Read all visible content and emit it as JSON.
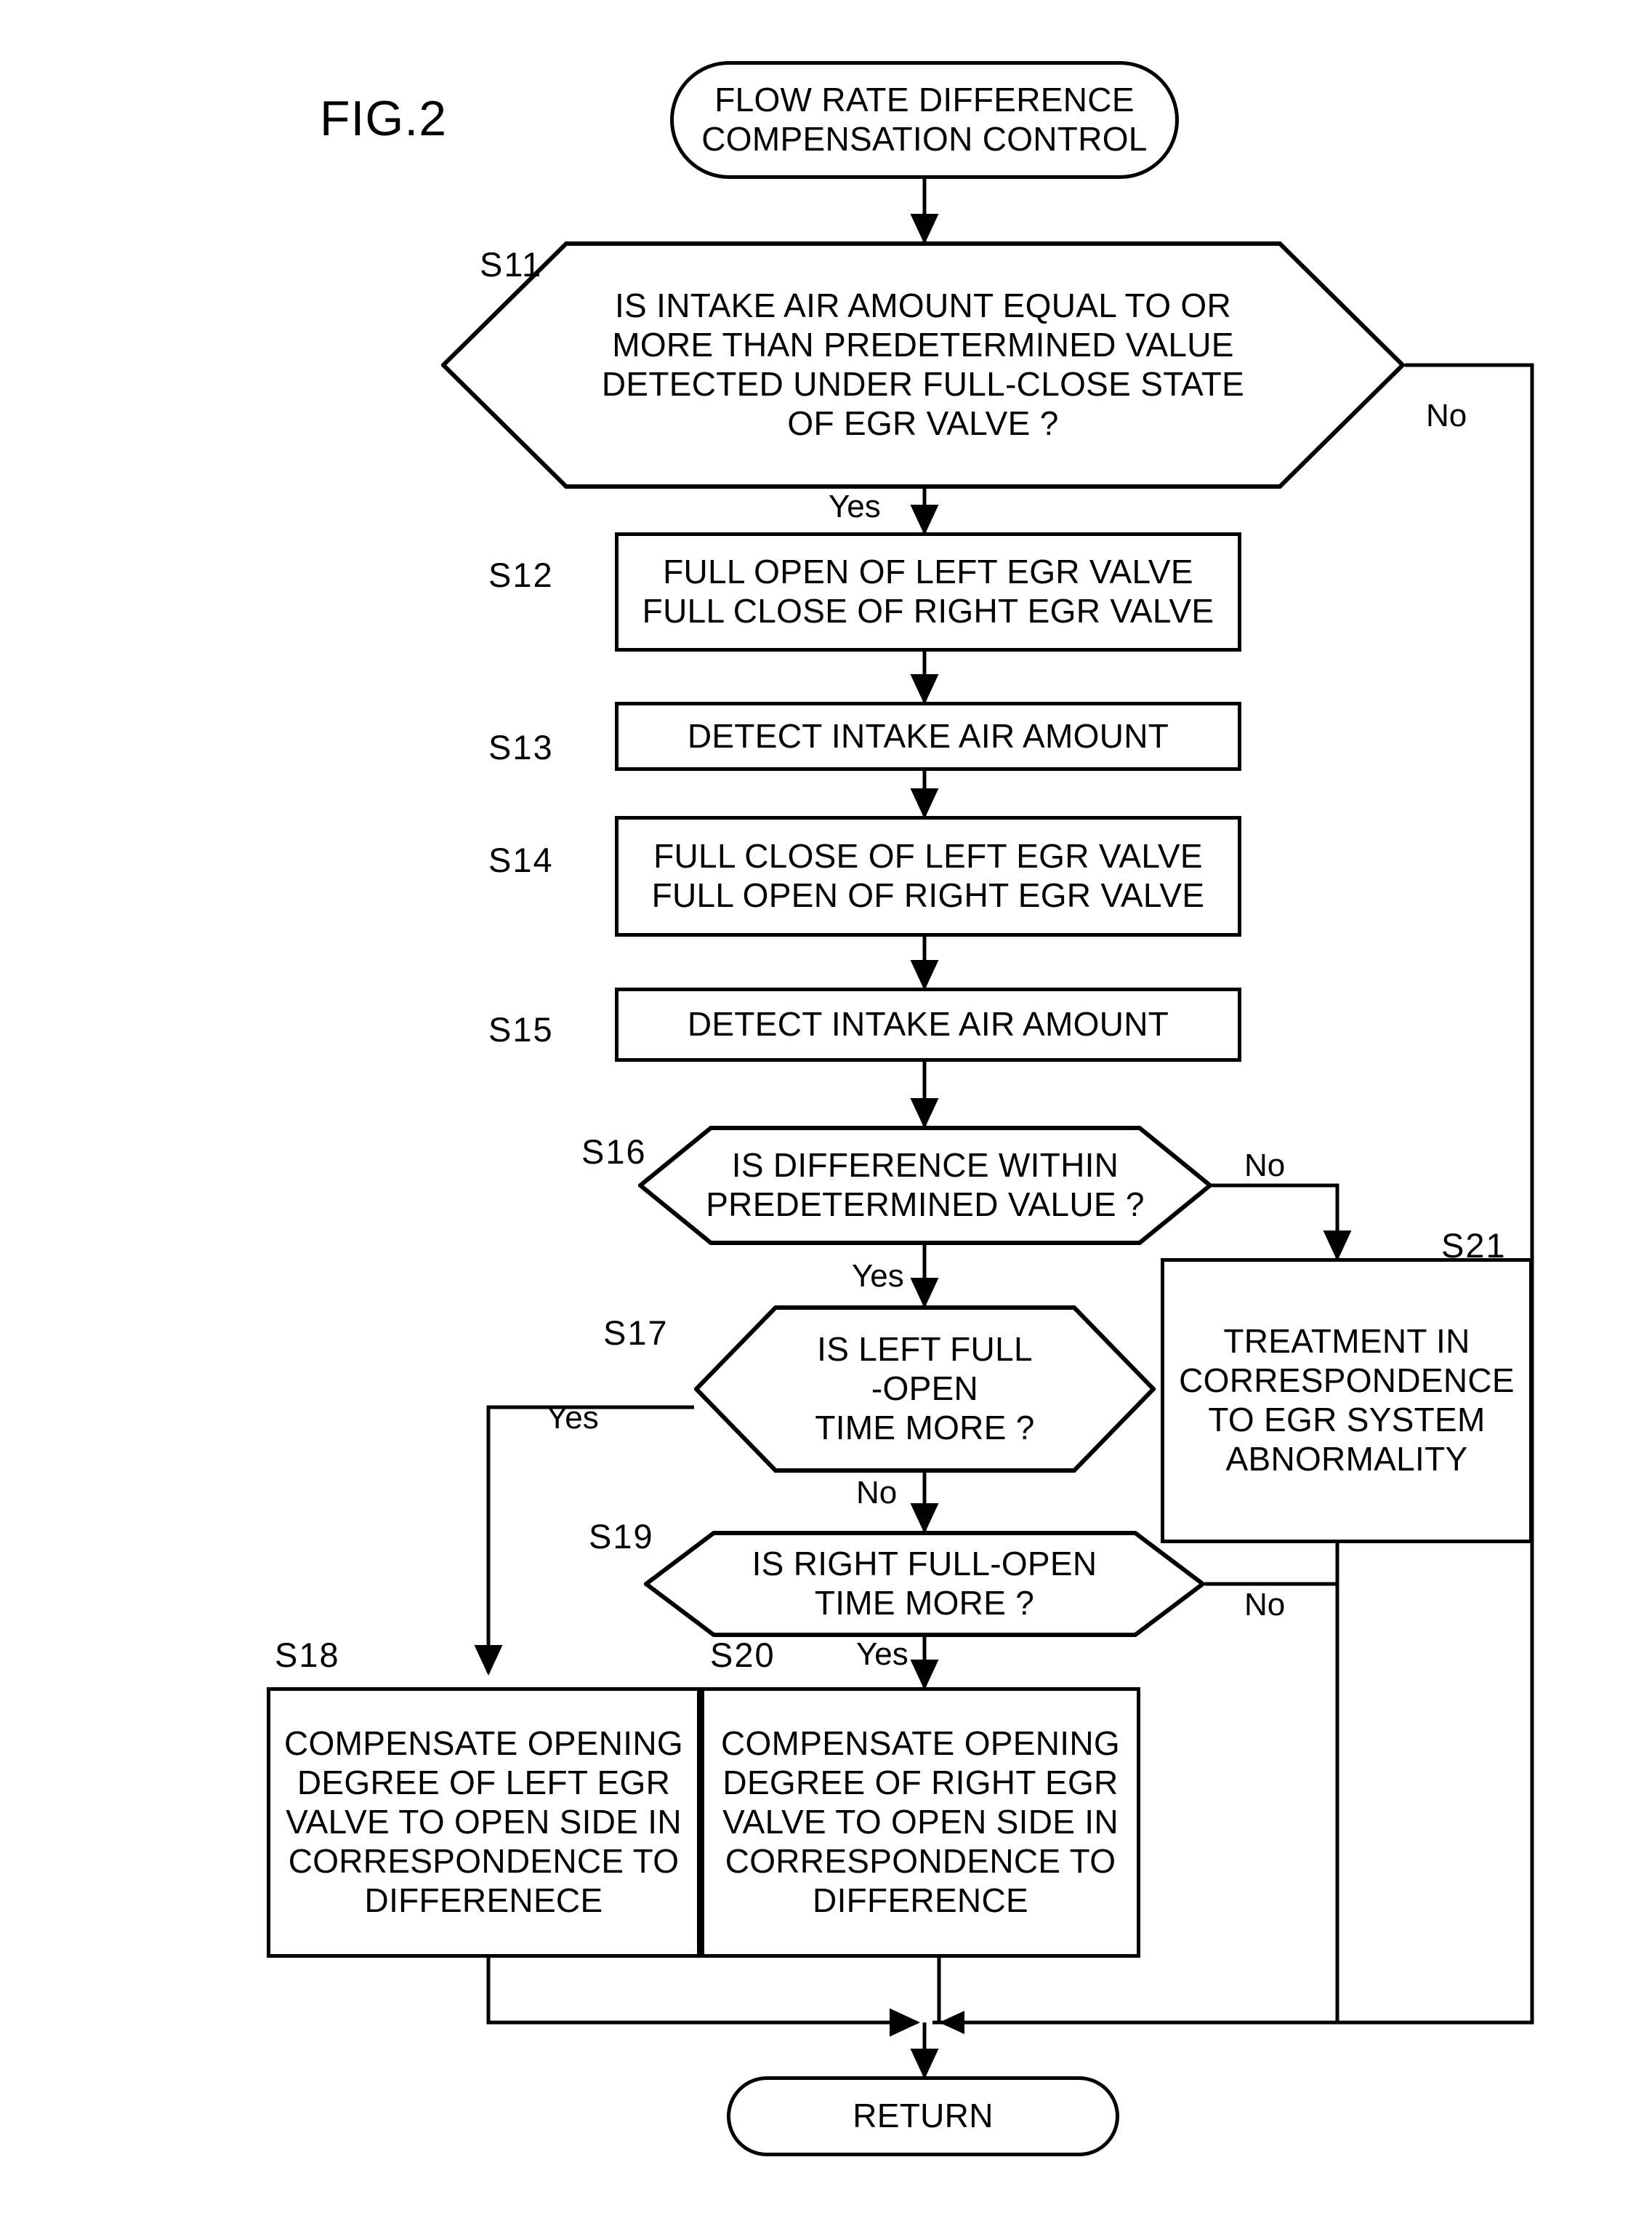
{
  "figure": {
    "label": "FIG.2"
  },
  "nodes": {
    "start": {
      "id": "start",
      "type": "terminator",
      "text": "FLOW RATE DIFFERENCE\nCOMPENSATION CONTROL"
    },
    "s11": {
      "id": "S11",
      "type": "decision",
      "step": "S11",
      "text": "IS INTAKE AIR AMOUNT EQUAL TO OR\nMORE THAN PREDETERMINED VALUE\nDETECTED UNDER FULL-CLOSE STATE\nOF EGR VALVE ?"
    },
    "s12": {
      "id": "S12",
      "type": "process",
      "step": "S12",
      "text": "FULL OPEN OF LEFT EGR VALVE\nFULL CLOSE OF RIGHT EGR VALVE"
    },
    "s13": {
      "id": "S13",
      "type": "process",
      "step": "S13",
      "text": "DETECT INTAKE AIR AMOUNT"
    },
    "s14": {
      "id": "S14",
      "type": "process",
      "step": "S14",
      "text": "FULL CLOSE OF LEFT EGR VALVE\nFULL OPEN OF RIGHT EGR VALVE"
    },
    "s15": {
      "id": "S15",
      "type": "process",
      "step": "S15",
      "text": "DETECT INTAKE AIR AMOUNT"
    },
    "s16": {
      "id": "S16",
      "type": "decision",
      "step": "S16",
      "text": "IS DIFFERENCE WITHIN\nPREDETERMINED VALUE ?"
    },
    "s17": {
      "id": "S17",
      "type": "decision",
      "step": "S17",
      "text": "IS LEFT FULL\n-OPEN\nTIME MORE ?"
    },
    "s19": {
      "id": "S19",
      "type": "decision",
      "step": "S19",
      "text": "IS RIGHT FULL-OPEN\nTIME MORE ?"
    },
    "s18": {
      "id": "S18",
      "type": "process",
      "step": "S18",
      "text": "COMPENSATE OPENING\nDEGREE OF LEFT EGR\nVALVE TO OPEN SIDE IN\nCORRESPONDENCE TO\nDIFFERENECE"
    },
    "s20": {
      "id": "S20",
      "type": "process",
      "step": "S20",
      "text": "COMPENSATE OPENING\nDEGREE OF RIGHT EGR\nVALVE TO OPEN SIDE IN\nCORRESPONDENCE TO\nDIFFERENCE"
    },
    "s21": {
      "id": "S21",
      "type": "process",
      "step": "S21",
      "text": "TREATMENT IN\nCORRESPONDENCE\nTO EGR SYSTEM\nABNORMALITY"
    },
    "return": {
      "id": "return",
      "type": "terminator",
      "text": "RETURN"
    }
  },
  "edge_labels": {
    "s11_no": "No",
    "s11_yes": "Yes",
    "s16_no": "No",
    "s16_yes": "Yes",
    "s17_yes": "Yes",
    "s17_no": "No",
    "s19_no": "No",
    "s19_yes": "Yes"
  },
  "colors": {
    "stroke": "#000000",
    "background": "#ffffff"
  }
}
